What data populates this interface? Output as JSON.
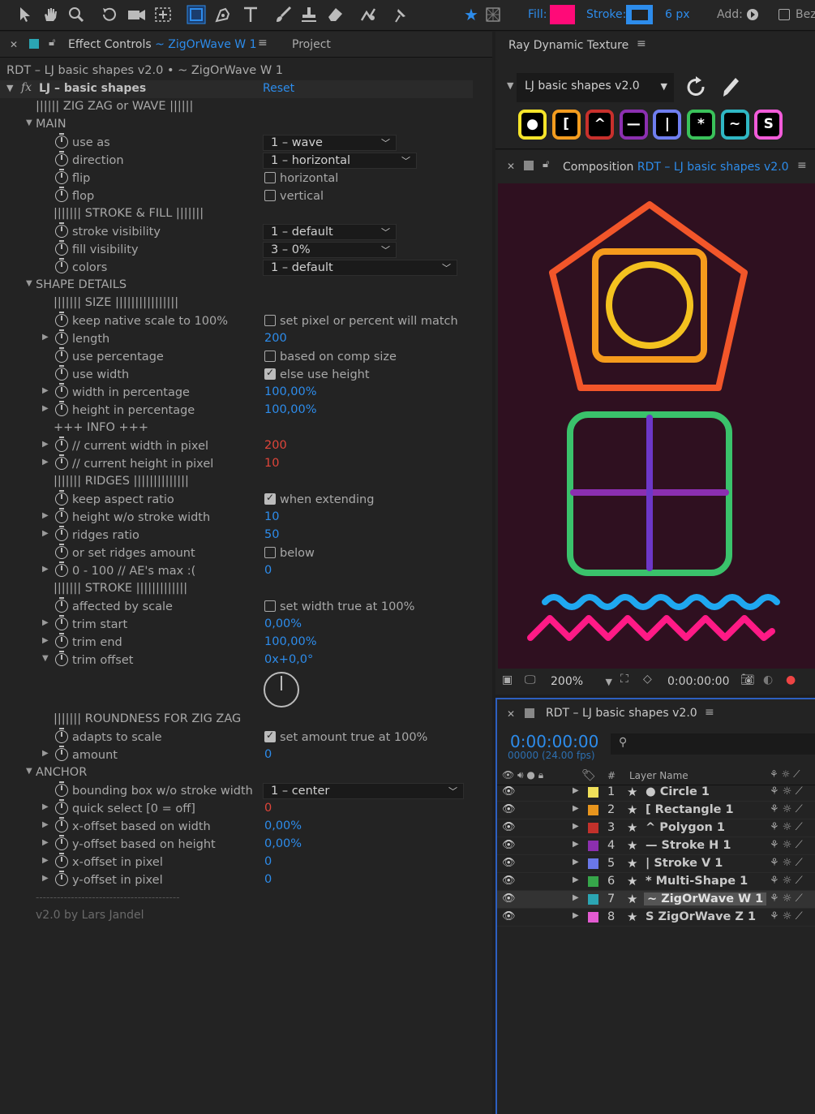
{
  "toolbar": {
    "fill_label": "Fill:",
    "stroke_label": "Stroke:",
    "stroke_px": "6 px",
    "add_label": "Add:",
    "bez_label": "Bez",
    "fill_color": "#ff0a78",
    "stroke_color": "#2d8ceb"
  },
  "effect_panel": {
    "tab": "Effect Controls",
    "tab_layer": "~ ZigOrWave W 1",
    "tab2": "Project",
    "breadcrumb": "RDT – LJ basic shapes v2.0 • ~ ZigOrWave W 1",
    "effect_name": "LJ – basic shapes",
    "fx": "fx",
    "reset": "Reset"
  },
  "rows": [
    {
      "t": "text",
      "indent": 44,
      "label": "||||||  ZIG ZAG or WAVE  ||||||"
    },
    {
      "t": "group",
      "label": "MAIN"
    },
    {
      "t": "dd",
      "label": "use as",
      "value": "1 – wave",
      "w": 165
    },
    {
      "t": "dd",
      "label": "direction",
      "value": "1 – horizontal",
      "w": 190
    },
    {
      "t": "cb",
      "label": "flip",
      "value": "horizontal",
      "on": false
    },
    {
      "t": "cb",
      "label": "flop",
      "value": "vertical",
      "on": false
    },
    {
      "t": "text",
      "indent": 66,
      "label": "|||||||  STROKE & FILL  |||||||"
    },
    {
      "t": "dd",
      "label": "stroke visibility",
      "value": "1 – default",
      "w": 165
    },
    {
      "t": "dd",
      "label": "fill visibility",
      "value": "3 – 0%",
      "w": 165
    },
    {
      "t": "dd",
      "label": "colors",
      "value": "1 – default",
      "w": 240
    },
    {
      "t": "group",
      "label": "SHAPE DETAILS"
    },
    {
      "t": "text",
      "indent": 66,
      "label": "|||||||  SIZE  ||||||||||||||||"
    },
    {
      "t": "cb",
      "label": "keep native scale to 100%",
      "value": "set pixel or percent will match",
      "on": false
    },
    {
      "t": "val",
      "label": "length",
      "value": "200",
      "tw": true
    },
    {
      "t": "cb",
      "label": "use percentage",
      "value": "based on comp size",
      "on": false
    },
    {
      "t": "cb",
      "label": "use width",
      "value": "else use height",
      "on": true
    },
    {
      "t": "val",
      "label": "width in percentage",
      "value": "100,00%",
      "tw": true
    },
    {
      "t": "val",
      "label": "height in percentage",
      "value": "100,00%",
      "tw": true
    },
    {
      "t": "text",
      "indent": 66,
      "label": "+++ INFO +++"
    },
    {
      "t": "val",
      "label": "// current width in pixel",
      "value": "200",
      "tw": true,
      "red": true
    },
    {
      "t": "val",
      "label": "// current height in pixel",
      "value": "10",
      "tw": true,
      "red": true
    },
    {
      "t": "text",
      "indent": 66,
      "label": "|||||||  RIDGES  ||||||||||||||"
    },
    {
      "t": "cb",
      "label": "keep aspect ratio",
      "value": "when extending",
      "on": true
    },
    {
      "t": "val",
      "label": "height w/o stroke width",
      "value": "10",
      "tw": true
    },
    {
      "t": "val",
      "label": "ridges ratio",
      "value": "50",
      "tw": true
    },
    {
      "t": "cb",
      "label": "or set ridges amount",
      "value": "below",
      "on": false
    },
    {
      "t": "val",
      "label": "0 - 100       // AE's max :(",
      "value": "0",
      "tw": true
    },
    {
      "t": "text",
      "indent": 66,
      "label": "|||||||  STROKE  |||||||||||||"
    },
    {
      "t": "cb",
      "label": "affected by scale",
      "value": "set width true at 100%",
      "on": false
    },
    {
      "t": "val",
      "label": "trim start",
      "value": "0,00%",
      "tw": true
    },
    {
      "t": "val",
      "label": "trim end",
      "value": "100,00%",
      "tw": true
    },
    {
      "t": "val",
      "label": "trim offset",
      "value": "0x+0,0°",
      "tw": true,
      "open": true
    }
  ],
  "rows2": [
    {
      "t": "text",
      "indent": 66,
      "label": "|||||||  ROUNDNESS FOR ZIG ZAG"
    },
    {
      "t": "cb",
      "label": "adapts to scale",
      "value": "set amount true at 100%",
      "on": true
    },
    {
      "t": "val",
      "label": "amount",
      "value": "0",
      "tw": true
    },
    {
      "t": "group",
      "label": "ANCHOR"
    },
    {
      "t": "dd",
      "label": "bounding box w/o stroke width",
      "value": "1 – center",
      "w": 248
    },
    {
      "t": "val",
      "label": "quick select [0 = off]",
      "value": "0",
      "tw": true,
      "red": true
    },
    {
      "t": "val",
      "label": "x-offset based on width",
      "value": "0,00%",
      "tw": true
    },
    {
      "t": "val",
      "label": "y-offset based on height",
      "value": "0,00%",
      "tw": true
    },
    {
      "t": "val",
      "label": "x-offset in pixel",
      "value": "0",
      "tw": true
    },
    {
      "t": "val",
      "label": "y-offset in pixel",
      "value": "0",
      "tw": true
    }
  ],
  "footer": {
    "line": "-----------------------------------------",
    "credit": "v2.0 by Lars Jandel"
  },
  "ray": {
    "title": "Ray Dynamic Texture",
    "preset": "LJ basic shapes v2.0",
    "buttons": [
      {
        "g": "●",
        "c": "#f5e42a"
      },
      {
        "g": "[",
        "c": "#f39c1f"
      },
      {
        "g": "^",
        "c": "#c8302c"
      },
      {
        "g": "—",
        "c": "#8b2fb0"
      },
      {
        "g": "|",
        "c": "#6f7ef0"
      },
      {
        "g": "*",
        "c": "#3ac25a"
      },
      {
        "g": "~",
        "c": "#2fb7c4"
      },
      {
        "g": "S",
        "c": "#f25bd9"
      }
    ]
  },
  "comp": {
    "title": "Composition",
    "name": "RDT – LJ basic shapes v2.0",
    "zoom": "200%",
    "time": "0:00:00:00"
  },
  "timeline": {
    "title": "RDT – LJ basic shapes v2.0",
    "timecode": "0:00:00:00",
    "frames": "00000 (24.00 fps)",
    "col_num": "#",
    "col_name": "Layer Name",
    "layers": [
      {
        "n": "1",
        "name": "● Circle 1",
        "c": "#f0e05a"
      },
      {
        "n": "2",
        "name": "[ Rectangle 1",
        "c": "#e8951d"
      },
      {
        "n": "3",
        "name": "^ Polygon 1",
        "c": "#c2312b"
      },
      {
        "n": "4",
        "name": "— Stroke H 1",
        "c": "#8c2fae"
      },
      {
        "n": "5",
        "name": "| Stroke V 1",
        "c": "#6a78e8"
      },
      {
        "n": "6",
        "name": "* Multi-Shape 1",
        "c": "#36a64a"
      },
      {
        "n": "7",
        "name": "~ ZigOrWave W 1",
        "c": "#2ba5b3",
        "sel": true
      },
      {
        "n": "8",
        "name": "S ZigOrWave Z 1",
        "c": "#e35bd1"
      }
    ]
  }
}
